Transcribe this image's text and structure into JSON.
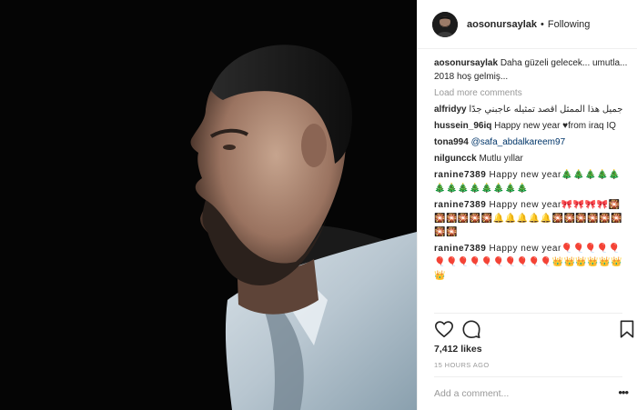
{
  "post": {
    "photo_alt": "Profile portrait of a bearded man in a light denim shirt against a black background"
  },
  "header": {
    "username": "aosonursaylak",
    "separator": "•",
    "follow_state": "Following"
  },
  "comments": {
    "caption_user": "aosonursaylak",
    "caption_text": "Daha güzeli gelecek... umutla... 2018 hoş gelmiş...",
    "load_more": "Load more comments",
    "items": [
      {
        "user": "alfridyy",
        "text": "جميل هذا الممثل اقصد تمثيله عاجبني جدًا"
      },
      {
        "user": "hussein_96iq",
        "text": "Happy new year ♥from iraq IQ"
      },
      {
        "user": "tona994",
        "text": "@safa_abdalkareem97"
      },
      {
        "user": "nilguncck",
        "text": "Mutlu yıllar"
      },
      {
        "user": "ranine7389",
        "text": "Happy new year🎄🎄🎄🎄🎄🎄🎄🎄🎄🎄🎄🎄🎄"
      },
      {
        "user": "ranine7389",
        "text": "Happy new year🎀🎀🎀🎀🎇🎇🎇🎇🎇🎇🔔🔔🔔🔔🔔🎇🎇🎇🎇🎇🎇🎇🎇"
      },
      {
        "user": "ranine7389",
        "text": "Happy new year🎈🎈🎈🎈🎈🎈🎈🎈🎈🎈🎈🎈🎈🎈🎈👑👑👑👑👑👑👑"
      }
    ]
  },
  "stats": {
    "likes": "7,412 likes",
    "time_ago": "15 HOURS AGO"
  },
  "footer": {
    "comment_placeholder": "Add a comment...",
    "more_label": "•••"
  },
  "icons": {
    "like": "heart-icon",
    "comment": "comment-bubble-icon",
    "save": "bookmark-icon"
  },
  "colors": {
    "text": "#262626",
    "muted": "#999999",
    "mention": "#003569",
    "photo_bg": "#050505"
  }
}
